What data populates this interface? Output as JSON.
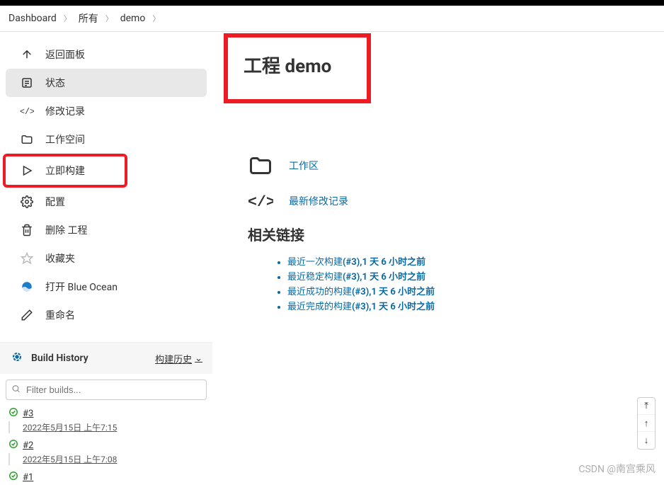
{
  "breadcrumb": {
    "items": [
      "Dashboard",
      "所有",
      "demo"
    ]
  },
  "sidebar": {
    "items": [
      {
        "icon": "arrow-up",
        "label": "返回面板"
      },
      {
        "icon": "status",
        "label": "状态",
        "active": true
      },
      {
        "icon": "changes",
        "label": "修改记录"
      },
      {
        "icon": "folder",
        "label": "工作空间"
      },
      {
        "icon": "play",
        "label": "立即构建",
        "highlight": true
      },
      {
        "icon": "gear",
        "label": "配置"
      },
      {
        "icon": "trash",
        "label": "删除 工程"
      },
      {
        "icon": "star",
        "label": "收藏夹"
      },
      {
        "icon": "blueocean",
        "label": "打开 Blue Ocean"
      },
      {
        "icon": "edit",
        "label": "重命名"
      }
    ]
  },
  "buildHistory": {
    "title": "Build History",
    "link": "构建历史",
    "filterPlaceholder": "Filter builds...",
    "builds": [
      {
        "num": "#3",
        "date": "2022年5月15日 上午7:15"
      },
      {
        "num": "#2",
        "date": "2022年5月15日 上午7:08"
      },
      {
        "num": "#1",
        "date": ""
      }
    ]
  },
  "content": {
    "title": "工程 demo",
    "quickLinks": [
      {
        "icon": "folder",
        "label": "工作区"
      },
      {
        "icon": "changes",
        "label": "最新修改记录"
      }
    ],
    "relatedTitle": "相关链接",
    "relatedLinks": [
      {
        "prefix": "最近一次构建",
        "suffix": "(#3),1 天 6 小时之前"
      },
      {
        "prefix": "最近稳定构建",
        "suffix": "(#3),1 天 6 小时之前"
      },
      {
        "prefix": "最近成功的构建",
        "suffix": "(#3),1 天 6 小时之前"
      },
      {
        "prefix": "最近完成的构建",
        "suffix": "(#3),1 天 6 小时之前"
      }
    ]
  },
  "watermark": "CSDN @南宫乘风"
}
